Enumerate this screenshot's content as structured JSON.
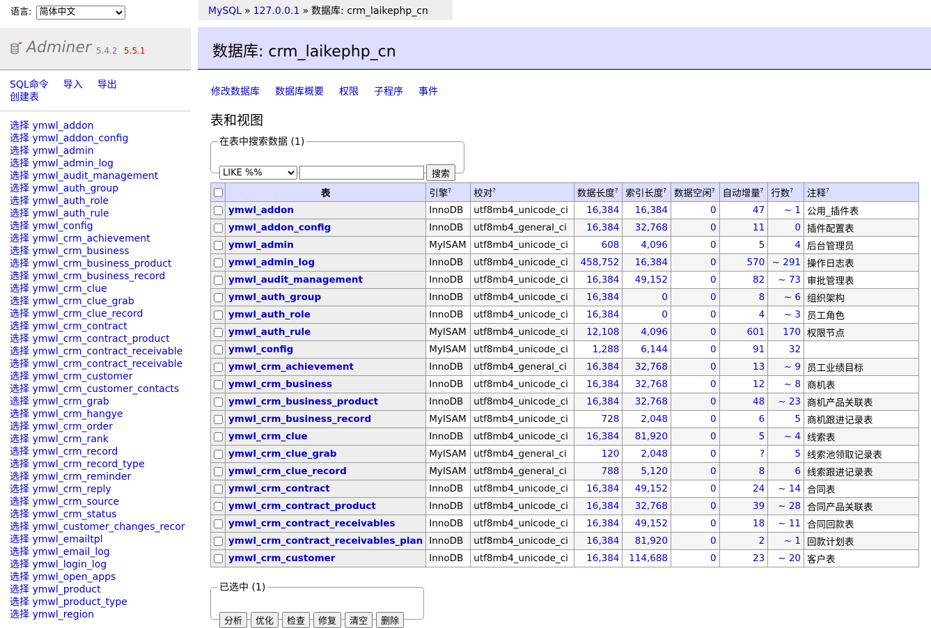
{
  "lang": {
    "label": "语言:",
    "selected": "简体中文"
  },
  "breadcrumb": {
    "system": "MySQL",
    "server": "127.0.0.1",
    "db_label": "数据库: crm_laikephp_cn",
    "sep": "»"
  },
  "logo": {
    "name": "Adminer",
    "version": "5.4.2",
    "new_version": "5.5.1"
  },
  "menu": {
    "sql": "SQL命令",
    "import": "导入",
    "export": "导出",
    "create": "创建表",
    "select_prefix": "选择"
  },
  "sidebar_tables": [
    "ymwl_addon",
    "ymwl_addon_config",
    "ymwl_admin",
    "ymwl_admin_log",
    "ymwl_audit_management",
    "ymwl_auth_group",
    "ymwl_auth_role",
    "ymwl_auth_rule",
    "ymwl_config",
    "ymwl_crm_achievement",
    "ymwl_crm_business",
    "ymwl_crm_business_product",
    "ymwl_crm_business_record",
    "ymwl_crm_clue",
    "ymwl_crm_clue_grab",
    "ymwl_crm_clue_record",
    "ymwl_crm_contract",
    "ymwl_crm_contract_product",
    "ymwl_crm_contract_receivable",
    "ymwl_crm_contract_receivable",
    "ymwl_crm_customer",
    "ymwl_crm_customer_contacts",
    "ymwl_crm_grab",
    "ymwl_crm_hangye",
    "ymwl_crm_order",
    "ymwl_crm_rank",
    "ymwl_crm_record",
    "ymwl_crm_record_type",
    "ymwl_crm_reminder",
    "ymwl_crm_reply",
    "ymwl_crm_source",
    "ymwl_crm_status",
    "ymwl_customer_changes_recor",
    "ymwl_emailtpl",
    "ymwl_email_log",
    "ymwl_login_log",
    "ymwl_open_apps",
    "ymwl_product",
    "ymwl_product_type",
    "ymwl_region"
  ],
  "main": {
    "title": "数据库: crm_laikephp_cn",
    "links": [
      "修改数据库",
      "数据库概要",
      "权限",
      "子程序",
      "事件"
    ],
    "section": "表和视图"
  },
  "search": {
    "legend": "在表中搜索数据 (1)",
    "operator": "LIKE %%",
    "value": "",
    "button": "搜索"
  },
  "table": {
    "headers": {
      "table": "表",
      "engine": "引擎",
      "collation": "校对",
      "data_length": "数据长度",
      "index_length": "索引长度",
      "data_free": "数据空闲",
      "auto_increment": "自动增量",
      "rows": "行数",
      "comment": "注释",
      "help": "?"
    },
    "rows": [
      [
        "ymwl_addon",
        "InnoDB",
        "utf8mb4_unicode_ci",
        "16,384",
        "16,384",
        "0",
        "47",
        "~ 1",
        "公用_插件表"
      ],
      [
        "ymwl_addon_config",
        "InnoDB",
        "utf8mb4_general_ci",
        "16,384",
        "32,768",
        "0",
        "11",
        "0",
        "插件配置表"
      ],
      [
        "ymwl_admin",
        "MyISAM",
        "utf8mb4_unicode_ci",
        "608",
        "4,096",
        "0",
        "5",
        "4",
        "后台管理员"
      ],
      [
        "ymwl_admin_log",
        "InnoDB",
        "utf8mb4_unicode_ci",
        "458,752",
        "16,384",
        "0",
        "570",
        "~ 291",
        "操作日志表"
      ],
      [
        "ymwl_audit_management",
        "InnoDB",
        "utf8mb4_unicode_ci",
        "16,384",
        "49,152",
        "0",
        "82",
        "~ 73",
        "审批管理表"
      ],
      [
        "ymwl_auth_group",
        "InnoDB",
        "utf8mb4_unicode_ci",
        "16,384",
        "0",
        "0",
        "8",
        "~ 6",
        "组织架构"
      ],
      [
        "ymwl_auth_role",
        "InnoDB",
        "utf8mb4_unicode_ci",
        "16,384",
        "0",
        "0",
        "4",
        "~ 3",
        "员工角色"
      ],
      [
        "ymwl_auth_rule",
        "MyISAM",
        "utf8mb4_unicode_ci",
        "12,108",
        "4,096",
        "0",
        "601",
        "170",
        "权限节点"
      ],
      [
        "ymwl_config",
        "MyISAM",
        "utf8mb4_unicode_ci",
        "1,288",
        "6,144",
        "0",
        "91",
        "32",
        ""
      ],
      [
        "ymwl_crm_achievement",
        "InnoDB",
        "utf8mb4_general_ci",
        "16,384",
        "32,768",
        "0",
        "13",
        "~ 9",
        "员工业绩目标"
      ],
      [
        "ymwl_crm_business",
        "InnoDB",
        "utf8mb4_unicode_ci",
        "16,384",
        "32,768",
        "0",
        "12",
        "~ 8",
        "商机表"
      ],
      [
        "ymwl_crm_business_product",
        "InnoDB",
        "utf8mb4_unicode_ci",
        "16,384",
        "32,768",
        "0",
        "48",
        "~ 23",
        "商机产品关联表"
      ],
      [
        "ymwl_crm_business_record",
        "MyISAM",
        "utf8mb4_unicode_ci",
        "728",
        "2,048",
        "0",
        "6",
        "5",
        "商机跟进记录表"
      ],
      [
        "ymwl_crm_clue",
        "InnoDB",
        "utf8mb4_unicode_ci",
        "16,384",
        "81,920",
        "0",
        "5",
        "~ 4",
        "线索表"
      ],
      [
        "ymwl_crm_clue_grab",
        "MyISAM",
        "utf8mb4_general_ci",
        "120",
        "2,048",
        "0",
        "?",
        "5",
        "线索池领取记录表"
      ],
      [
        "ymwl_crm_clue_record",
        "MyISAM",
        "utf8mb4_general_ci",
        "788",
        "5,120",
        "0",
        "8",
        "6",
        "线索跟进记录表"
      ],
      [
        "ymwl_crm_contract",
        "InnoDB",
        "utf8mb4_unicode_ci",
        "16,384",
        "49,152",
        "0",
        "24",
        "~ 14",
        "合同表"
      ],
      [
        "ymwl_crm_contract_product",
        "InnoDB",
        "utf8mb4_unicode_ci",
        "16,384",
        "32,768",
        "0",
        "39",
        "~ 28",
        "合同产品关联表"
      ],
      [
        "ymwl_crm_contract_receivables",
        "InnoDB",
        "utf8mb4_unicode_ci",
        "16,384",
        "49,152",
        "0",
        "18",
        "~ 11",
        "合同回款表"
      ],
      [
        "ymwl_crm_contract_receivables_plan",
        "InnoDB",
        "utf8mb4_unicode_ci",
        "16,384",
        "81,920",
        "0",
        "2",
        "~ 1",
        "回款计划表"
      ],
      [
        "ymwl_crm_customer",
        "InnoDB",
        "utf8mb4_unicode_ci",
        "16,384",
        "114,688",
        "0",
        "23",
        "~ 20",
        "客户表"
      ]
    ]
  },
  "selected": {
    "legend": "已选中 (1)",
    "buttons": [
      "分析",
      "优化",
      "检查",
      "修复",
      "清空",
      "删除"
    ]
  }
}
